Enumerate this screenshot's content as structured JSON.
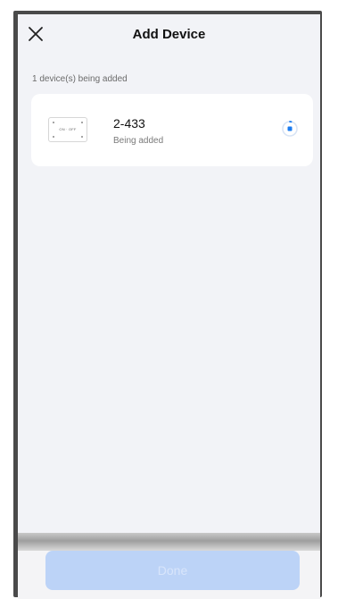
{
  "header": {
    "close_icon": "close-icon",
    "title": "Add Device"
  },
  "summary": {
    "count_text": "1 device(s) being added"
  },
  "devices": [
    {
      "name": "2-433",
      "status": "Being added",
      "thumbnail_label": "ON · OFF",
      "progress_icon": "loading-spinner-icon"
    }
  ],
  "footer": {
    "done_label": "Done",
    "done_enabled": false
  },
  "colors": {
    "accent": "#1a7bf0",
    "background": "#f2f3f7",
    "card": "#ffffff",
    "done_disabled_bg": "#bcd3f7"
  }
}
